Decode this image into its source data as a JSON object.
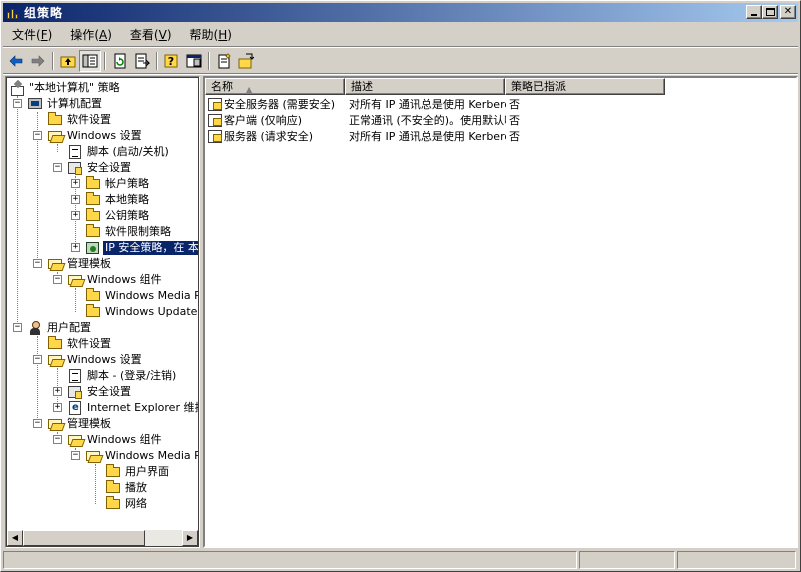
{
  "window": {
    "title": "组策略"
  },
  "menu": [
    {
      "label": "文件",
      "key": "F"
    },
    {
      "label": "操作",
      "key": "A"
    },
    {
      "label": "查看",
      "key": "V"
    },
    {
      "label": "帮助",
      "key": "H"
    }
  ],
  "toolbar": [
    "back-arrow-icon",
    "forward-arrow-icon",
    "up-folder-icon",
    "show-tree-icon",
    "refresh-icon",
    "export-list-icon",
    "help-icon",
    "properties-pane-icon",
    "new-policy-icon",
    "assign-policy-icon"
  ],
  "tree": {
    "root": "\"本地计算机\" 策略",
    "computer_config": "计算机配置",
    "cc_software": "软件设置",
    "cc_windows": "Windows 设置",
    "cc_scripts": "脚本 (启动/关机)",
    "cc_security": "安全设置",
    "cc_account": "帐户策略",
    "cc_local": "本地策略",
    "cc_pubkey": "公钥策略",
    "cc_srp": "软件限制策略",
    "cc_ipsec": "IP 安全策略，在 本地计算机",
    "cc_admin": "管理模板",
    "cc_wincomp": "Windows 组件",
    "cc_wmp": "Windows Media Player",
    "cc_wu": "Windows Update",
    "user_config": "用户配置",
    "uc_software": "软件设置",
    "uc_windows": "Windows 设置",
    "uc_scripts": "脚本 - (登录/注销)",
    "uc_security": "安全设置",
    "uc_ie": "Internet Explorer 维护",
    "uc_admin": "管理模板",
    "uc_wincomp": "Windows 组件",
    "uc_wmp": "Windows Media Player",
    "uc_ui": "用户界面",
    "uc_play": "播放",
    "uc_net": "网络"
  },
  "list": {
    "columns": [
      "名称",
      "描述",
      "策略已指派"
    ],
    "rows": [
      {
        "name": "安全服务器 (需要安全)",
        "desc": "对所有 IP 通讯总是使用 Kerberos 信任请求安全",
        "assigned": "否"
      },
      {
        "name": "客户端 (仅响应)",
        "desc": "正常通讯 (不安全的)。使用默认响应规则",
        "assigned": "否"
      },
      {
        "name": "服务器 (请求安全)",
        "desc": "对所有 IP 通讯总是使用 Kerberos 信任请求安全",
        "assigned": "否"
      }
    ]
  }
}
